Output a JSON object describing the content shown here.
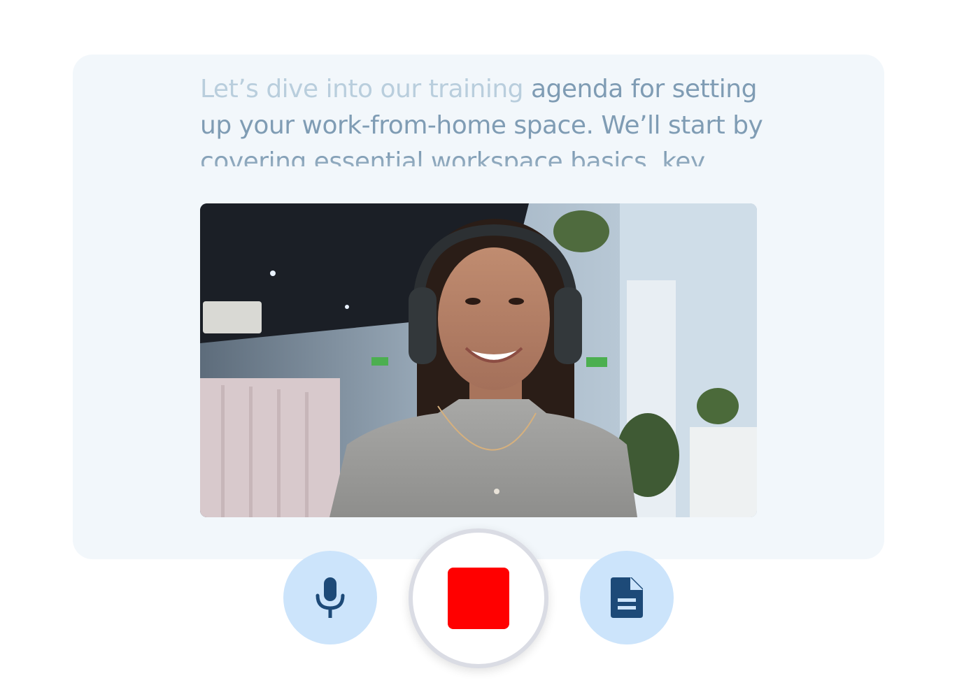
{
  "teleprompter": {
    "read_text": "Let’s dive into our training",
    "upcoming_text": " agenda for setting up your work-from-home space. We’ll start by covering essential workspace basics, key"
  },
  "video": {
    "subject": "Woman wearing headphones smiling at camera in an office",
    "icon": "video-feed"
  },
  "controls": {
    "microphone": {
      "icon": "mic-icon"
    },
    "record": {
      "icon": "stop-icon",
      "color": "#ff0000"
    },
    "notes": {
      "icon": "document-icon"
    }
  },
  "colors": {
    "card_bg": "#f2f7fb",
    "text_read": "#b9cedd",
    "text_upcoming": "#7f9cb4",
    "button_bg": "#cce4fb",
    "icon_color": "#1d4a78",
    "record_red": "#ff0000"
  }
}
